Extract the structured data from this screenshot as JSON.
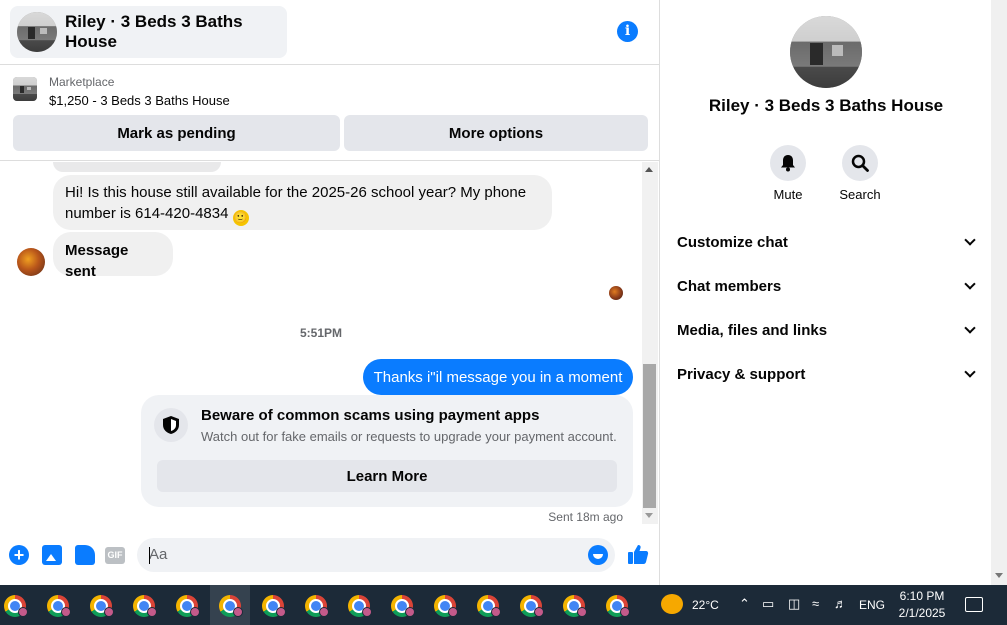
{
  "chat": {
    "title": "Riley · 3 Beds 3 Baths House",
    "info_icon": "info-icon",
    "listing": {
      "source": "Marketplace",
      "title": "$1,250 - 3 Beds 3 Baths House"
    },
    "buttons": {
      "pending": "Mark as pending",
      "more": "More options"
    },
    "messages": {
      "msg1_line1": "Hi! Is this house still available for the 2025-26 school year? My phone",
      "msg1_line2": "number is 614-420-4834",
      "msg1_emoji": "🙂",
      "msg2": "Message sent",
      "timestamp": "5:51PM",
      "outgoing": "Thanks i\"il message you in a moment",
      "scam_title": "Beware of common scams using payment apps",
      "scam_text": "Watch out for fake emails or requests to upgrade your payment account.",
      "learn_more": "Learn More",
      "sent_status": "Sent 18m ago"
    },
    "composer": {
      "placeholder": "Aa",
      "gif_label": "GIF",
      "plus_label": "+"
    }
  },
  "info_panel": {
    "title": "Riley · 3 Beds 3 Baths House",
    "actions": [
      {
        "label": "Mute",
        "icon": "bell-icon"
      },
      {
        "label": "Search",
        "icon": "search-icon"
      }
    ],
    "sections": [
      "Customize chat",
      "Chat members",
      "Media, files and links",
      "Privacy & support"
    ]
  },
  "taskbar": {
    "temperature": "22°C",
    "language": "ENG",
    "time": "6:10 PM",
    "date": "2/1/2025"
  },
  "colors": {
    "accent": "#0a7cff",
    "bubble_in": "#f0f0f0",
    "taskbar": "#1c2a38"
  }
}
